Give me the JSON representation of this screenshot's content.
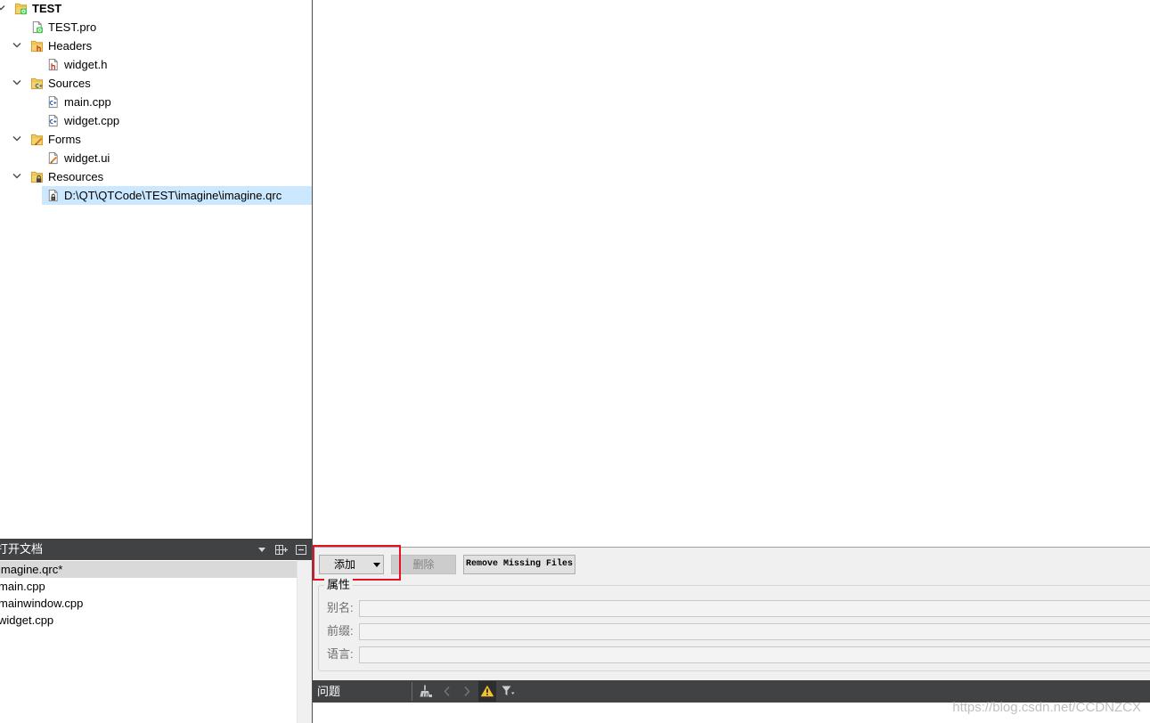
{
  "colors": {
    "selection": "#cce8ff",
    "doc_selection": "#d9d9d9",
    "dark_bar": "#404244",
    "panel_bg": "#f0f0f0",
    "highlight_box": "#e81123",
    "warning": "#f2c230"
  },
  "project_tree": {
    "items": [
      {
        "label": "TEST",
        "icon": "qt-project-icon",
        "expanded": true
      },
      {
        "label": "TEST.pro",
        "icon": "pro-file-icon"
      },
      {
        "label": "Headers",
        "icon": "headers-folder-icon",
        "expanded": true
      },
      {
        "label": "widget.h",
        "icon": "header-file-icon"
      },
      {
        "label": "Sources",
        "icon": "sources-folder-icon",
        "expanded": true
      },
      {
        "label": "main.cpp",
        "icon": "cpp-file-icon"
      },
      {
        "label": "widget.cpp",
        "icon": "cpp-file-icon"
      },
      {
        "label": "Forms",
        "icon": "forms-folder-icon",
        "expanded": true
      },
      {
        "label": "widget.ui",
        "icon": "ui-file-icon"
      },
      {
        "label": "Resources",
        "icon": "resources-folder-icon",
        "expanded": true
      },
      {
        "label": "D:\\QT\\QTCode\\TEST\\imagine\\imagine.qrc",
        "icon": "qrc-file-icon",
        "selected": true
      }
    ]
  },
  "open_documents": {
    "title": "打开文档",
    "toolbar_icons": [
      "dropdown-arrow-icon",
      "split-add-icon",
      "close-panel-icon"
    ],
    "items": [
      {
        "label": "imagine.qrc*",
        "selected": true
      },
      {
        "label": "main.cpp"
      },
      {
        "label": "mainwindow.cpp"
      },
      {
        "label": "widget.cpp"
      }
    ]
  },
  "resource_editor": {
    "add_button": "添加",
    "delete_button": "删除",
    "delete_enabled": false,
    "remove_missing_button": "Remove Missing Files",
    "properties": {
      "title": "属性",
      "fields": [
        {
          "label": "别名:",
          "value": ""
        },
        {
          "label": "前缀:",
          "value": ""
        },
        {
          "label": "语言:",
          "value": ""
        }
      ]
    }
  },
  "issues_panel": {
    "title": "问题",
    "toolbar_icons": [
      "clear-icon",
      "previous-icon",
      "next-icon",
      "warning-filter-icon",
      "filter-icon"
    ]
  },
  "watermark": "https://blog.csdn.net/CCDNZCX"
}
